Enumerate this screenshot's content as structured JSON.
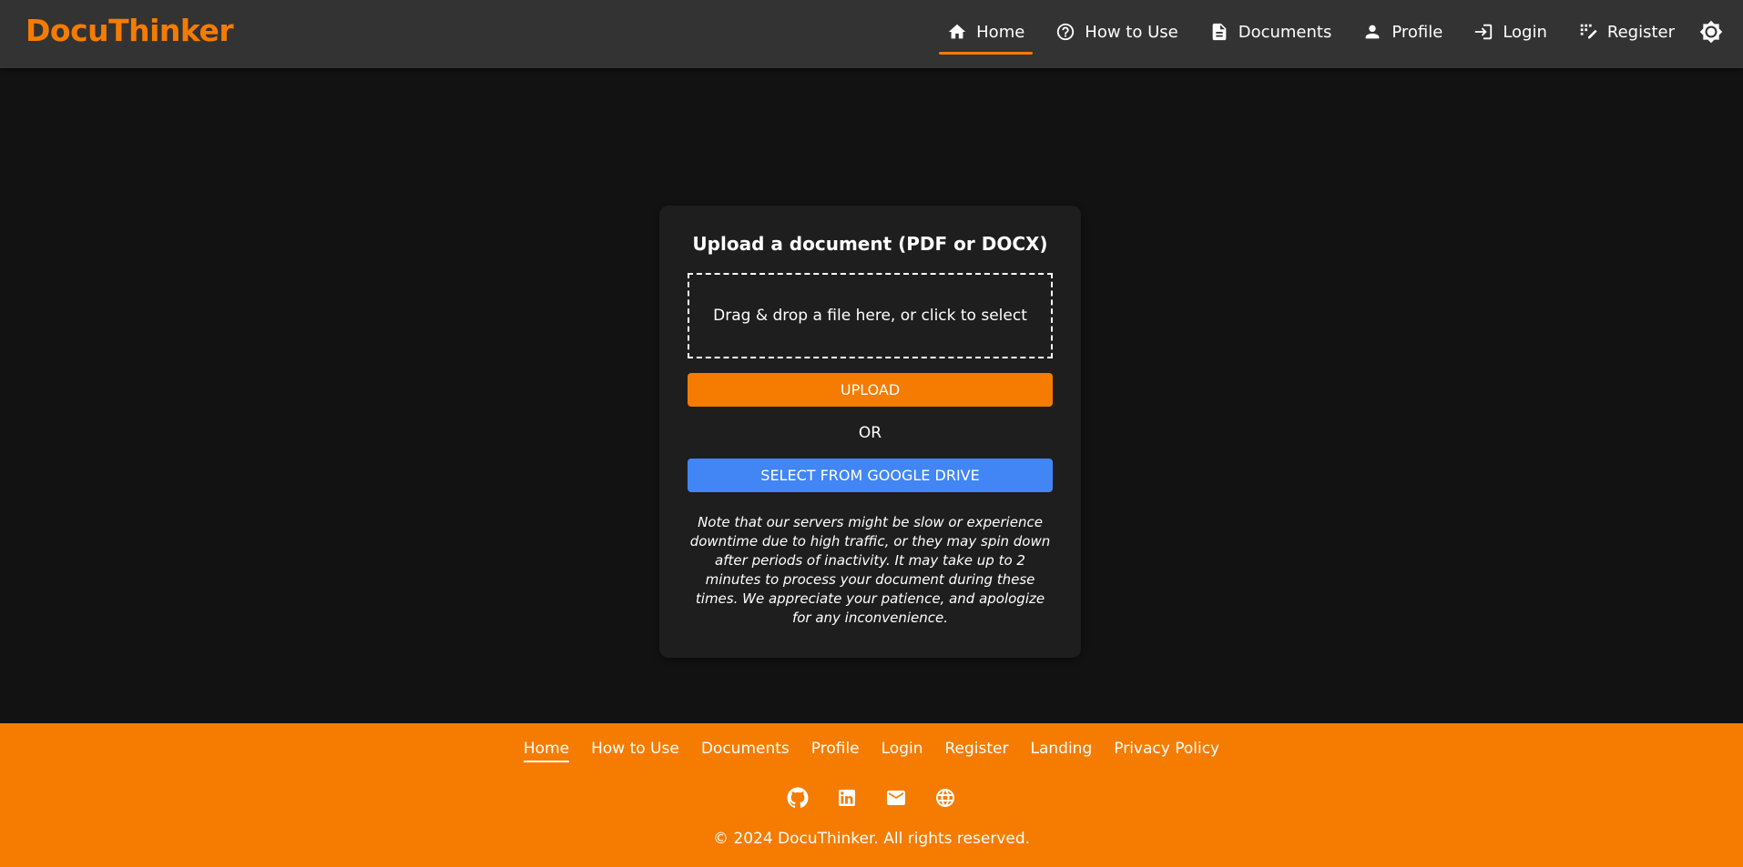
{
  "brand": "DocuThinker",
  "nav": {
    "items": [
      {
        "label": "Home",
        "icon": "home-icon",
        "active": true
      },
      {
        "label": "How to Use",
        "icon": "help-circle-icon"
      },
      {
        "label": "Documents",
        "icon": "document-icon"
      },
      {
        "label": "Profile",
        "icon": "person-icon"
      },
      {
        "label": "Login",
        "icon": "login-icon"
      },
      {
        "label": "Register",
        "icon": "register-icon"
      }
    ],
    "theme_toggle_icon": "brightness-icon"
  },
  "upload_card": {
    "title": "Upload a document (PDF or DOCX)",
    "dropzone_text": "Drag & drop a file here, or click to select",
    "upload_button": "UPLOAD",
    "or_text": "OR",
    "drive_button": "SELECT FROM GOOGLE DRIVE",
    "note": "Note that our servers might be slow or experience downtime due to high traffic, or they may spin down after periods of inactivity. It may take up to 2 minutes to process your document during these times. We appreciate your patience, and apologize for any inconvenience."
  },
  "footer": {
    "links": [
      {
        "label": "Home",
        "active": true
      },
      {
        "label": "How to Use"
      },
      {
        "label": "Documents"
      },
      {
        "label": "Profile"
      },
      {
        "label": "Login"
      },
      {
        "label": "Register"
      },
      {
        "label": "Landing"
      },
      {
        "label": "Privacy Policy"
      }
    ],
    "icons": [
      "github-icon",
      "linkedin-icon",
      "email-icon",
      "globe-icon"
    ],
    "copyright": "© 2024 DocuThinker. All rights reserved."
  },
  "colors": {
    "accent": "#f57c00",
    "google_blue": "#4285f4",
    "background": "#121212",
    "navbar": "#333333",
    "card": "#1e1e1e"
  }
}
